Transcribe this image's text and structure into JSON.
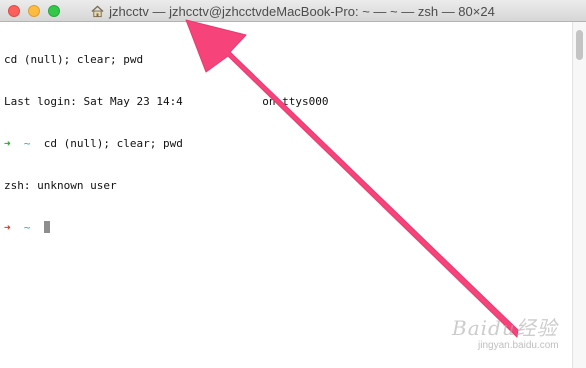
{
  "window": {
    "title": "jzhcctv — jzhcctv@jzhcctvdeMacBook-Pro: ~ — ~ — zsh — 80×24"
  },
  "terminal": {
    "line1": "cd (null); clear; pwd",
    "line2": "Last login: Sat May 23 14:4",
    "line2_tail": "on ttys000",
    "prompt_arrow": "➜",
    "prompt_dir": "~",
    "line3_cmd": "cd (null); clear; pwd",
    "line4": "zsh: unknown user"
  },
  "icons": {
    "title_icon": "home-folder-icon",
    "annotation": "pink-arrow-annotation"
  },
  "colors": {
    "annotation_arrow": "#f6437a",
    "prompt_success": "#2ea52e",
    "prompt_error": "#d63b2b",
    "prompt_dir": "#2aa7b8"
  },
  "watermark": {
    "brand": "Baidu经验",
    "site": "jingyan.baidu.com"
  }
}
